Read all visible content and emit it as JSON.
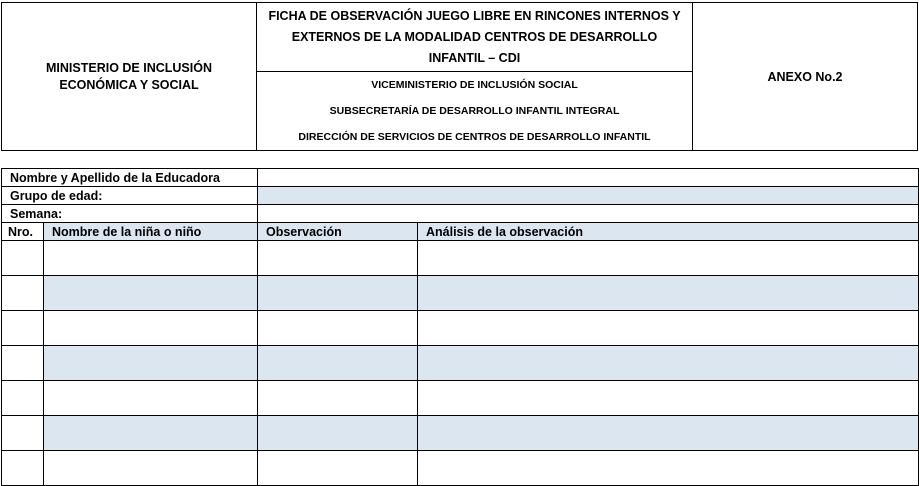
{
  "header": {
    "ministry": "MINISTERIO DE INCLUSIÓN ECONÓMICA Y SOCIAL",
    "title": "FICHA DE OBSERVACIÓN JUEGO LIBRE EN RINCONES INTERNOS Y EXTERNOS DE LA MODALIDAD CENTROS DE DESARROLLO INFANTIL – CDI",
    "viceministry": "VICEMINISTERIO DE INCLUSIÓN SOCIAL",
    "subsecretary": "SUBSECRETARÍA DE DESARROLLO INFANTIL INTEGRAL",
    "direction": "DIRECCIÓN DE SERVICIOS DE CENTROS DE DESARROLLO INFANTIL",
    "annex": "ANEXO No.2"
  },
  "form": {
    "educator_label": "Nombre y Apellido de la Educadora",
    "age_group_label": "Grupo de edad:",
    "week_label": "Semana:",
    "columns": {
      "number": "Nro.",
      "child_name": "Nombre de la niña o niño",
      "observation": "Observación",
      "analysis": "Análisis de la observación"
    }
  },
  "colors": {
    "shade": "#dce6f1",
    "border": "#000000"
  }
}
